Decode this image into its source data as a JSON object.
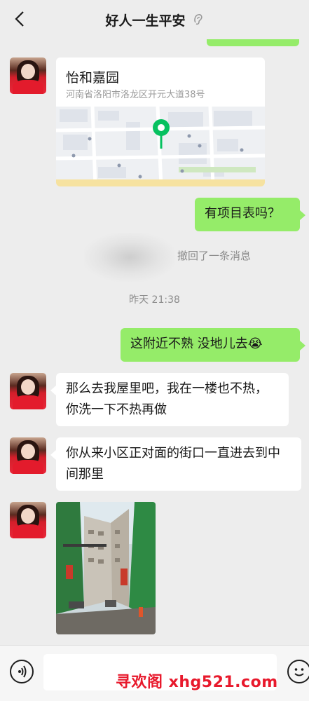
{
  "header": {
    "title": "好人一生平安",
    "back_icon": "chevron-left-icon",
    "mode_icon": "ear-icon"
  },
  "messages": {
    "location": {
      "name": "怡和嘉园",
      "address": "河南省洛阳市洛龙区开元大道38号"
    },
    "out_1": "有项目表吗？",
    "recall": "撤回了一条消息",
    "time": "昨天 21:38",
    "out_2": "这附近不熟 没地儿去",
    "out_2_emoji": "😭",
    "in_1": "那么去我屋里吧，我在一楼也不热，你洗一下不热再做",
    "in_2": "你从来小区正对面的街口一直进去到中间那里"
  },
  "input_bar": {
    "voice_icon": "voice-icon",
    "emoji_icon": "smiley-icon",
    "placeholder": ""
  },
  "watermark": "寻欢阁 xhg521.com",
  "colors": {
    "outgoing": "#95ec69",
    "incoming": "#ffffff",
    "background": "#ededed",
    "pin": "#07c160",
    "watermark": "#e8192c"
  }
}
